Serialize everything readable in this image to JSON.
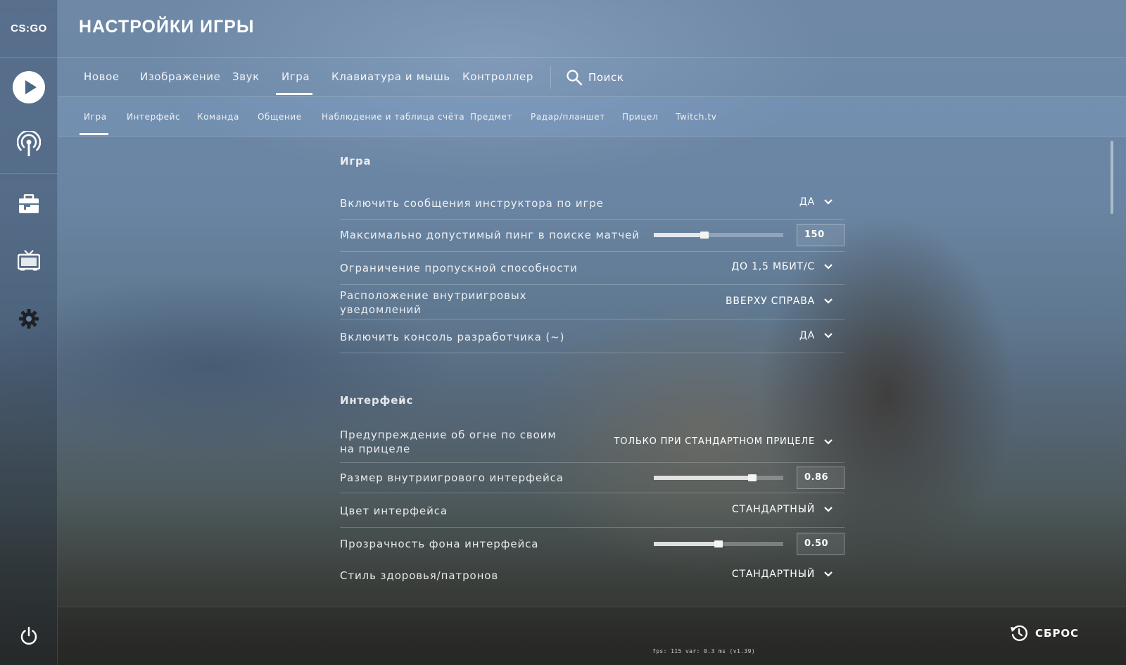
{
  "logo": {
    "text": "CS:GO"
  },
  "header": {
    "title": "НАСТРОЙКИ ИГРЫ"
  },
  "tabs": [
    {
      "label": "Новое"
    },
    {
      "label": "Изображение"
    },
    {
      "label": "Звук"
    },
    {
      "label": "Игра",
      "active": true
    },
    {
      "label": "Клавиатура и мышь"
    },
    {
      "label": "Контроллер"
    }
  ],
  "search": {
    "label": "Поиск",
    "icon": "search-icon"
  },
  "subtabs": [
    {
      "label": "Игра",
      "active": true
    },
    {
      "label": "Интерфейс"
    },
    {
      "label": "Команда"
    },
    {
      "label": "Общение"
    },
    {
      "label": "Наблюдение и таблица счёта"
    },
    {
      "label": "Предмет"
    },
    {
      "label": "Радар/планшет"
    },
    {
      "label": "Прицел"
    },
    {
      "label": "Twitch.tv"
    }
  ],
  "sections": {
    "game": {
      "title": "Игра",
      "rows": [
        {
          "label": "Включить сообщения инструктора по игре",
          "type": "dropdown",
          "value": "ДА"
        },
        {
          "label": "Максимально допустимый пинг в поиске матчей",
          "type": "slider",
          "value": "150",
          "fill": 0.39
        },
        {
          "label": "Ограничение пропускной способности",
          "type": "dropdown",
          "value": "ДО 1,5 МБИТ/С"
        },
        {
          "label": "Расположение внутриигровых уведомлений",
          "type": "dropdown",
          "value": "ВВЕРХУ СПРАВА"
        },
        {
          "label": "Включить консоль разработчика (~)",
          "type": "dropdown",
          "value": "ДА"
        }
      ]
    },
    "interface": {
      "title": "Интерфейс",
      "rows": [
        {
          "label": "Предупреждение об огне по своим на прицеле",
          "type": "dropdown",
          "value": "ТОЛЬКО ПРИ СТАНДАРТНОМ ПРИЦЕЛЕ"
        },
        {
          "label": "Размер внутриигрового интерфейса",
          "type": "slider",
          "value": "0.86",
          "fill": 0.76
        },
        {
          "label": "Цвет интерфейса",
          "type": "dropdown",
          "value": "СТАНДАРТНЫЙ"
        },
        {
          "label": "Прозрачность фона интерфейса",
          "type": "slider",
          "value": "0.50",
          "fill": 0.5
        },
        {
          "label": "Стиль здоровья/патронов",
          "type": "dropdown",
          "value": "СТАНДАРТНЫЙ"
        }
      ]
    }
  },
  "footer": {
    "reset_label": "СБРОС",
    "netgraph": "fps:   115  var:   0.3 ms  (v1.39)"
  },
  "colors": {
    "text": "#ffffff",
    "tab_underline": "#ffffff",
    "subtab_bar": "#8aa5c8"
  }
}
